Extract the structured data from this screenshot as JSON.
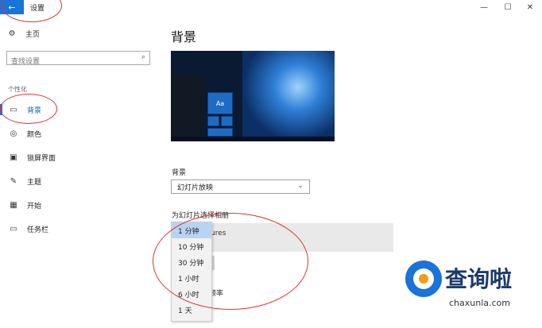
{
  "window": {
    "title": "设置",
    "back_icon": "arrow-left-icon",
    "controls": {
      "minimize": "—",
      "maximize": "☐",
      "close": "✕"
    }
  },
  "sidebar": {
    "home_label": "主页",
    "home_icon": "gear-icon",
    "search_placeholder": "查找设置",
    "section": "个性化",
    "items": [
      {
        "label": "背景",
        "icon": "picture-icon",
        "active": true
      },
      {
        "label": "颜色",
        "icon": "palette-icon",
        "active": false
      },
      {
        "label": "锁屏界面",
        "icon": "lock-screen-icon",
        "active": false
      },
      {
        "label": "主题",
        "icon": "theme-icon",
        "active": false
      },
      {
        "label": "开始",
        "icon": "start-icon",
        "active": false
      },
      {
        "label": "任务栏",
        "icon": "taskbar-icon",
        "active": false
      }
    ]
  },
  "main": {
    "title": "背景",
    "preview_tile": "Aa",
    "background_label": "背景",
    "background_value": "幻灯片放映",
    "album_label": "为幻灯片选择相册",
    "album_name_partial": "ures",
    "frequency_partial": "频率"
  },
  "dropdown": {
    "selected_index": 0,
    "options": [
      "1 分钟",
      "10 分钟",
      "30 分钟",
      "1 小时",
      "6 小时",
      "1 天"
    ]
  },
  "watermark": {
    "text": "查询啦",
    "url": "chaxunla.com"
  },
  "colors": {
    "accent": "#1a73d8",
    "annotation": "#dd3333",
    "dropdown_selected": "#b7d4f2"
  }
}
